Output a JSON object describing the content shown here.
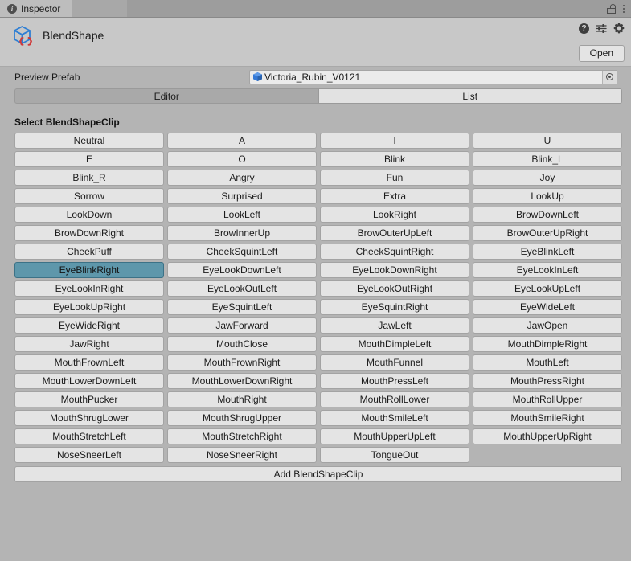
{
  "window": {
    "tab_label": "Inspector",
    "tab_icon": "info-icon",
    "lock_icon": "lock-icon",
    "menu_icon": "kebab-menu-icon"
  },
  "header": {
    "asset_icon": "scriptable-object-cube-icon",
    "asset_title": "BlendShape",
    "help_icon": "help-icon",
    "preset_icon": "preset-sliders-icon",
    "settings_icon": "gear-icon",
    "open_label": "Open"
  },
  "prefab": {
    "label": "Preview Prefab",
    "value": "Victoria_Rubin_V0121",
    "object_icon": "prefab-cube-icon",
    "picker_icon": "object-picker-target-icon"
  },
  "mode_tabs": {
    "items": [
      {
        "label": "Editor",
        "active": true
      },
      {
        "label": "List",
        "active": false
      }
    ]
  },
  "clips": {
    "section_title": "Select BlendShapeClip",
    "selected": "EyeBlinkRight",
    "add_label": "Add BlendShapeClip",
    "items": [
      "Neutral",
      "A",
      "I",
      "U",
      "E",
      "O",
      "Blink",
      "Blink_L",
      "Blink_R",
      "Angry",
      "Fun",
      "Joy",
      "Sorrow",
      "Surprised",
      "Extra",
      "LookUp",
      "LookDown",
      "LookLeft",
      "LookRight",
      "BrowDownLeft",
      "BrowDownRight",
      "BrowInnerUp",
      "BrowOuterUpLeft",
      "BrowOuterUpRight",
      "CheekPuff",
      "CheekSquintLeft",
      "CheekSquintRight",
      "EyeBlinkLeft",
      "EyeBlinkRight",
      "EyeLookDownLeft",
      "EyeLookDownRight",
      "EyeLookInLeft",
      "EyeLookInRight",
      "EyeLookOutLeft",
      "EyeLookOutRight",
      "EyeLookUpLeft",
      "EyeLookUpRight",
      "EyeSquintLeft",
      "EyeSquintRight",
      "EyeWideLeft",
      "EyeWideRight",
      "JawForward",
      "JawLeft",
      "JawOpen",
      "JawRight",
      "MouthClose",
      "MouthDimpleLeft",
      "MouthDimpleRight",
      "MouthFrownLeft",
      "MouthFrownRight",
      "MouthFunnel",
      "MouthLeft",
      "MouthLowerDownLeft",
      "MouthLowerDownRight",
      "MouthPressLeft",
      "MouthPressRight",
      "MouthPucker",
      "MouthRight",
      "MouthRollLower",
      "MouthRollUpper",
      "MouthShrugLower",
      "MouthShrugUpper",
      "MouthSmileLeft",
      "MouthSmileRight",
      "MouthStretchLeft",
      "MouthStretchRight",
      "MouthUpperUpLeft",
      "MouthUpperUpRight",
      "NoseSneerLeft",
      "NoseSneerRight",
      "TongueOut"
    ]
  },
  "colors": {
    "background": "#b4b4b4",
    "button": "#e4e4e4",
    "selected_button": "#5e97ab",
    "header": "#c8c8c8",
    "tabbar": "#9d9d9d"
  }
}
